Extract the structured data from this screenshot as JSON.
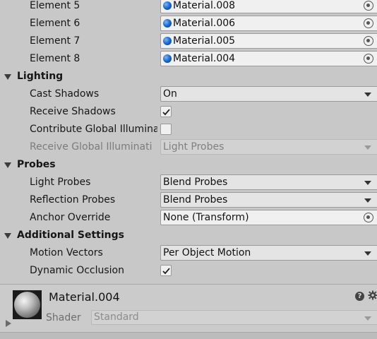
{
  "materials_list": [
    {
      "label": "Element 5",
      "value": "Material.008"
    },
    {
      "label": "Element 6",
      "value": "Material.006"
    },
    {
      "label": "Element 7",
      "value": "Material.005"
    },
    {
      "label": "Element 8",
      "value": "Material.004"
    }
  ],
  "lighting": {
    "title": "Lighting",
    "cast_shadows_label": "Cast Shadows",
    "cast_shadows_value": "On",
    "receive_shadows_label": "Receive Shadows",
    "receive_shadows_checked": true,
    "contribute_gi_label": "Contribute Global Illumina",
    "contribute_gi_checked": false,
    "receive_gi_label": "Receive Global Illuminati",
    "receive_gi_value": "Light Probes"
  },
  "probes": {
    "title": "Probes",
    "light_probes_label": "Light Probes",
    "light_probes_value": "Blend Probes",
    "reflection_probes_label": "Reflection Probes",
    "reflection_probes_value": "Blend Probes",
    "anchor_override_label": "Anchor Override",
    "anchor_override_value": "None (Transform)"
  },
  "additional": {
    "title": "Additional Settings",
    "motion_vectors_label": "Motion Vectors",
    "motion_vectors_value": "Per Object Motion",
    "dynamic_occlusion_label": "Dynamic Occlusion",
    "dynamic_occlusion_checked": true
  },
  "material_header": {
    "name": "Material.004",
    "shader_label": "Shader",
    "shader_value": "Standard",
    "help_glyph": "?"
  },
  "colors": {
    "panel_bg": "#c8c8c8",
    "material_dot": "#1d6fd8"
  }
}
